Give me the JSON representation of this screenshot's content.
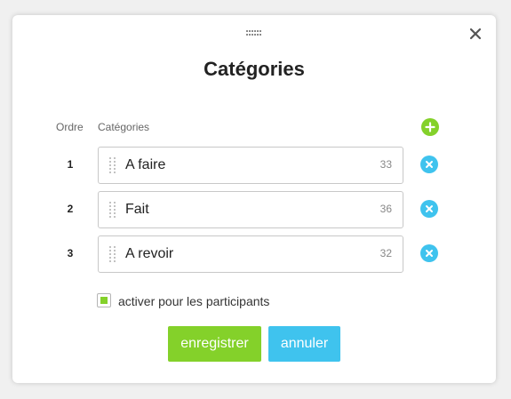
{
  "dialog": {
    "title": "Catégories",
    "close_icon": "close-icon",
    "drag_icon": "drag-handle-icon"
  },
  "columns": {
    "order": "Ordre",
    "categories": "Catégories"
  },
  "add_icon": "plus-circle-icon",
  "rows": [
    {
      "order": "1",
      "value": "A faire",
      "count": "33"
    },
    {
      "order": "2",
      "value": "Fait",
      "count": "36"
    },
    {
      "order": "3",
      "value": "A revoir",
      "count": "32"
    }
  ],
  "remove_icon": "x-circle-icon",
  "participants": {
    "label": "activer pour les participants",
    "checked": true
  },
  "buttons": {
    "save": "enregistrer",
    "cancel": "annuler"
  },
  "colors": {
    "accent_green": "#84d12a",
    "accent_blue": "#3fc3ee",
    "title_text": "#222222"
  }
}
